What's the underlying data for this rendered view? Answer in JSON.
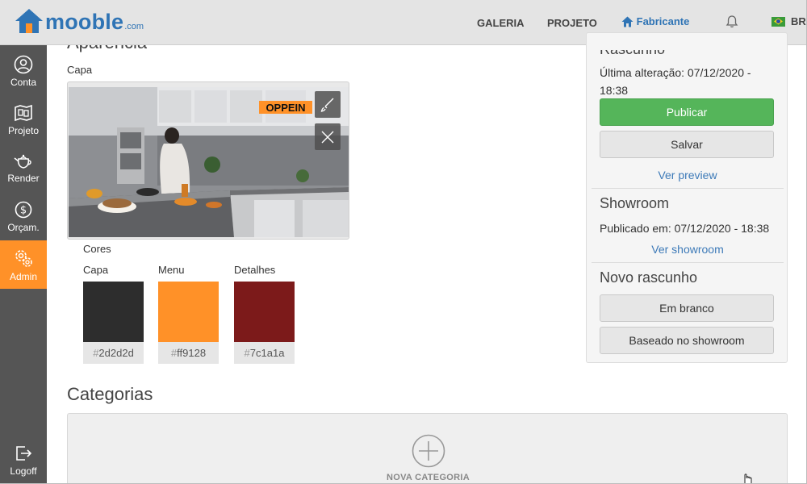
{
  "header": {
    "logo_text": "mooble",
    "logo_suffix": ".com",
    "nav": [
      {
        "label": "GALERIA"
      },
      {
        "label": "PROJETO"
      },
      {
        "label": "Fabricante",
        "active": true
      }
    ],
    "language": "BR"
  },
  "sidebar": {
    "items": [
      {
        "label": "Conta",
        "icon": "user-icon"
      },
      {
        "label": "Projeto",
        "icon": "blueprint-icon"
      },
      {
        "label": "Render",
        "icon": "teapot-icon"
      },
      {
        "label": "Orçam.",
        "icon": "dollar-icon"
      },
      {
        "label": "Admin",
        "icon": "gear-icon",
        "active": true
      },
      {
        "label": "Logoff",
        "icon": "logout-icon"
      }
    ]
  },
  "main": {
    "aparencia_title": "Aparência",
    "capa_label": "Capa",
    "cover_brand_text": "OPPEIN",
    "cores_label": "Cores",
    "colors": [
      {
        "label": "Capa",
        "hex": "2d2d2d",
        "color": "#2d2d2d"
      },
      {
        "label": "Menu",
        "hex": "ff9128",
        "color": "#ff9128"
      },
      {
        "label": "Detalhes",
        "hex": "7c1a1a",
        "color": "#7c1a1a"
      }
    ],
    "categorias_title": "Categorias",
    "nova_categoria_label": "NOVA CATEGORIA"
  },
  "panel": {
    "rascunho_title": "Rascunho",
    "ultima_alteracao": "Última alteração: 07/12/2020 - 18:38",
    "publicar_label": "Publicar",
    "salvar_label": "Salvar",
    "ver_preview_label": "Ver preview",
    "showroom_title": "Showroom",
    "publicado_em": "Publicado em: 07/12/2020 - 18:38",
    "ver_showroom_label": "Ver showroom",
    "novo_rascunho_title": "Novo rascunho",
    "em_branco_label": "Em branco",
    "baseado_label": "Baseado no showroom"
  },
  "colors": {
    "brand_blue": "#2f74b5",
    "accent_orange": "#ff9128",
    "success_green": "#55b55a",
    "sidebar_bg": "#555555"
  }
}
